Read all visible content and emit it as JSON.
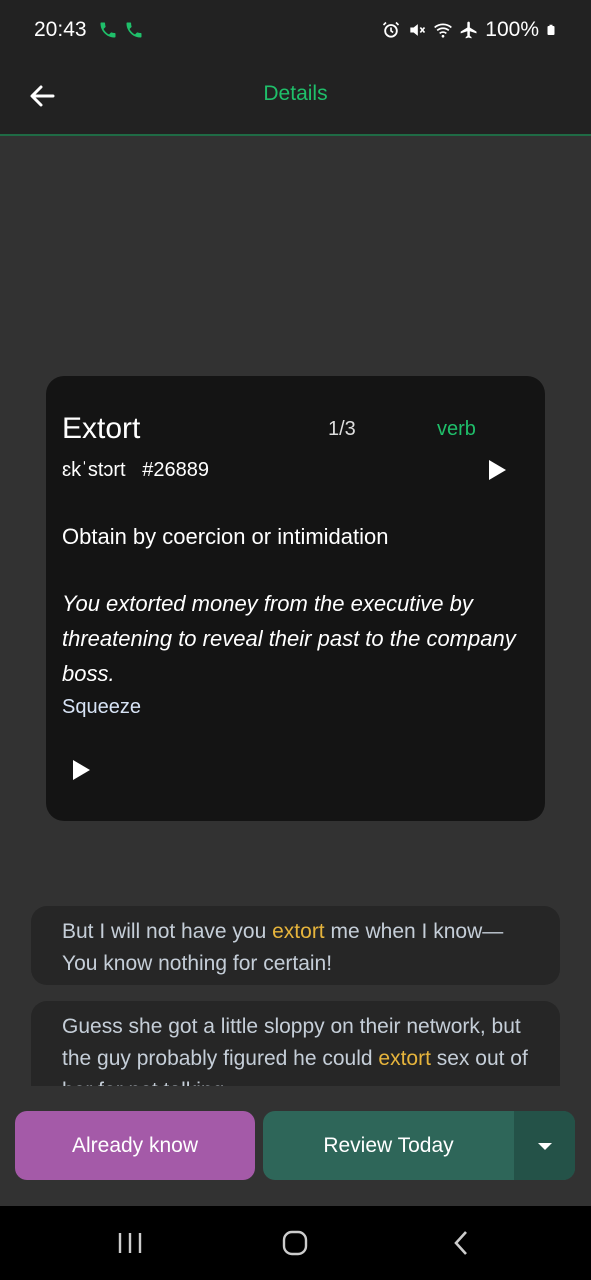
{
  "status_bar": {
    "time": "20:43",
    "battery": "100%",
    "icons": [
      "phone-call-icon",
      "phone-call-icon",
      "alarm-icon",
      "mute-icon",
      "wifi-icon",
      "airplane-icon",
      "battery-icon"
    ]
  },
  "appbar": {
    "title": "Details",
    "back_icon": "arrow-left-icon"
  },
  "card": {
    "word": "Extort",
    "counter": "1/3",
    "part_of_speech": "verb",
    "phonetic": "ɛkˈstɔrt   #26889",
    "definition": "Obtain by coercion or intimidation",
    "example": "You extorted money from the executive by threatening to reveal their past to the company boss.",
    "synonym": "Squeeze"
  },
  "examples": [
    {
      "before": "But I will not have you ",
      "highlight": "extort",
      "after": " me when I know— You know nothing for certain!"
    },
    {
      "before": "Guess she got a little sloppy on their network, but the guy probably figured he could ",
      "highlight": "extort",
      "after": " sex out of her for not talking."
    }
  ],
  "actions": {
    "already_know": "Already know",
    "review_today": "Review Today"
  },
  "colors": {
    "accent_green": "#1fbf6a",
    "already_know_bg": "#a45aa8",
    "review_bg": "#2e6659",
    "highlight": "#e6b43c"
  }
}
